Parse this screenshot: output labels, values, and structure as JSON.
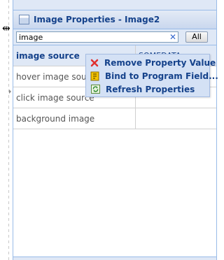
{
  "panel": {
    "title": "Image Properties - Image2"
  },
  "search": {
    "value": "image",
    "clear_glyph": "✕",
    "all_label": "All"
  },
  "grid": {
    "rows": [
      {
        "name": "image source",
        "value": "SOMEDATA",
        "selected": true
      },
      {
        "name": "hover image source",
        "value": ""
      },
      {
        "name": "click image source",
        "value": ""
      },
      {
        "name": "background image",
        "value": ""
      }
    ]
  },
  "context_menu": {
    "items": [
      {
        "label": "Remove Property Value",
        "icon": "red-x-icon"
      },
      {
        "label": "Bind to Program Field...",
        "icon": "bind-icon"
      },
      {
        "label": "Refresh Properties",
        "icon": "refresh-icon"
      }
    ]
  },
  "colors": {
    "title_text": "#15428b",
    "header_bg": "#dfe8f6",
    "border": "#99bbe8",
    "menu_bg": "#d4e1f5",
    "remove_icon": "#e03030"
  }
}
